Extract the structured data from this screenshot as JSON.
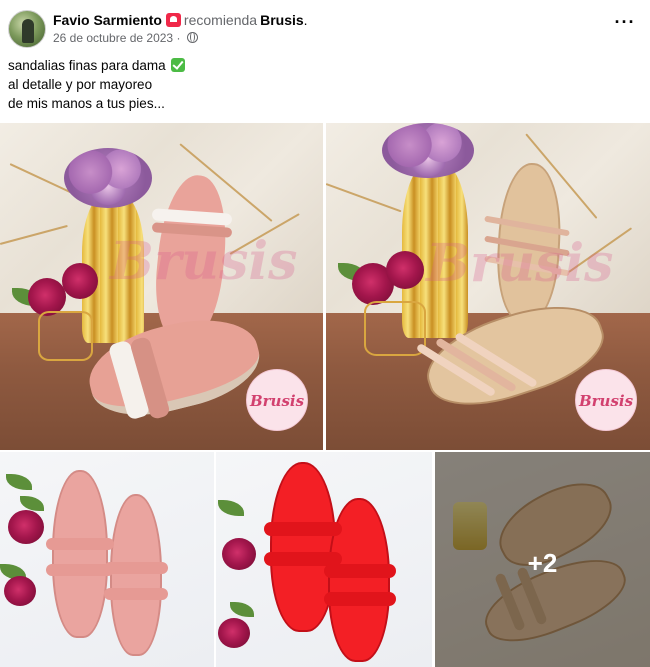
{
  "post": {
    "author": "Favio Sarmiento",
    "recommends_text": "recomienda",
    "page_name": "Brusis",
    "period": ".",
    "date": "26 de octubre de 2023",
    "date_sep": "·",
    "privacy_icon": "globe-icon",
    "more_icon": "ellipsis-icon",
    "more_glyph": "···",
    "lines": [
      "sandalias finas para dama",
      "al detalle y por mayoreo",
      "de mis manos a tus pies..."
    ]
  },
  "photos": {
    "watermark_text": "Brusis",
    "logo_text": "Brusis",
    "extra_count": "+2"
  },
  "colors": {
    "recommend_icon": "#f02849",
    "check_icon": "#4cbb45",
    "secondary_text": "#65676b"
  }
}
